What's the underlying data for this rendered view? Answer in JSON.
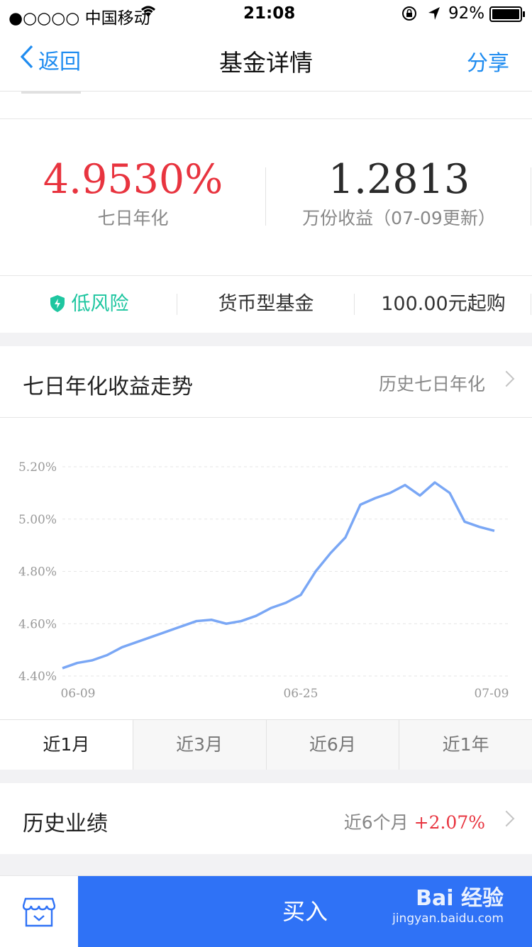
{
  "status_bar": {
    "carrier": "●○○○○ 中国移动",
    "time": "21:08",
    "battery": "92%"
  },
  "nav": {
    "back_label": "返回",
    "title": "基金详情",
    "share_label": "分享"
  },
  "returns": {
    "annualized_value": "4.9530%",
    "annualized_label": "七日年化",
    "per10k_value": "1.2813",
    "per10k_label": "万份收益（07-09更新）"
  },
  "tags": {
    "risk": "低风险",
    "type": "货币型基金",
    "minimum": "100.00元起购"
  },
  "colors": {
    "accent_blue": "#1f8cf0",
    "buy_blue": "#2f72f6",
    "red": "#e8343f",
    "risk_green": "#1ec6a0",
    "line_blue": "#7aa7f5"
  },
  "trend": {
    "title": "七日年化收益走势",
    "link": "历史七日年化"
  },
  "chart_data": {
    "type": "line",
    "x": [
      "06-09",
      "06-10",
      "06-11",
      "06-12",
      "06-13",
      "06-14",
      "06-15",
      "06-16",
      "06-17",
      "06-18",
      "06-19",
      "06-20",
      "06-21",
      "06-22",
      "06-23",
      "06-24",
      "06-25",
      "06-26",
      "06-27",
      "06-28",
      "06-29",
      "06-30",
      "07-01",
      "07-02",
      "07-03",
      "07-04",
      "07-05",
      "07-06",
      "07-07",
      "07-08",
      "07-09"
    ],
    "x_tick_labels": [
      "06-09",
      "06-25",
      "07-09"
    ],
    "y_tick_labels": [
      "5.20%",
      "5.00%",
      "4.80%",
      "4.60%",
      "4.40%"
    ],
    "series": [
      {
        "values": [
          4.43,
          4.45,
          4.46,
          4.48,
          4.51,
          4.53,
          4.55,
          4.57,
          4.59,
          4.61,
          4.615,
          4.6,
          4.61,
          4.63,
          4.66,
          4.68,
          4.71,
          4.8,
          4.87,
          4.93,
          5.055,
          5.08,
          5.1,
          5.13,
          5.09,
          5.14,
          5.1,
          4.99,
          4.97,
          4.955
        ]
      }
    ],
    "ylim": [
      4.4,
      5.2
    ],
    "grid": true
  },
  "periods": [
    "近1月",
    "近3月",
    "近6月",
    "近1年"
  ],
  "history": {
    "title": "历史业绩",
    "period_label": "近6个月",
    "value": "+2.07%"
  },
  "bottom": {
    "buy_label": "买入",
    "watermark_1": "Bai 经验",
    "watermark_2": "jingyan.baidu.com"
  }
}
